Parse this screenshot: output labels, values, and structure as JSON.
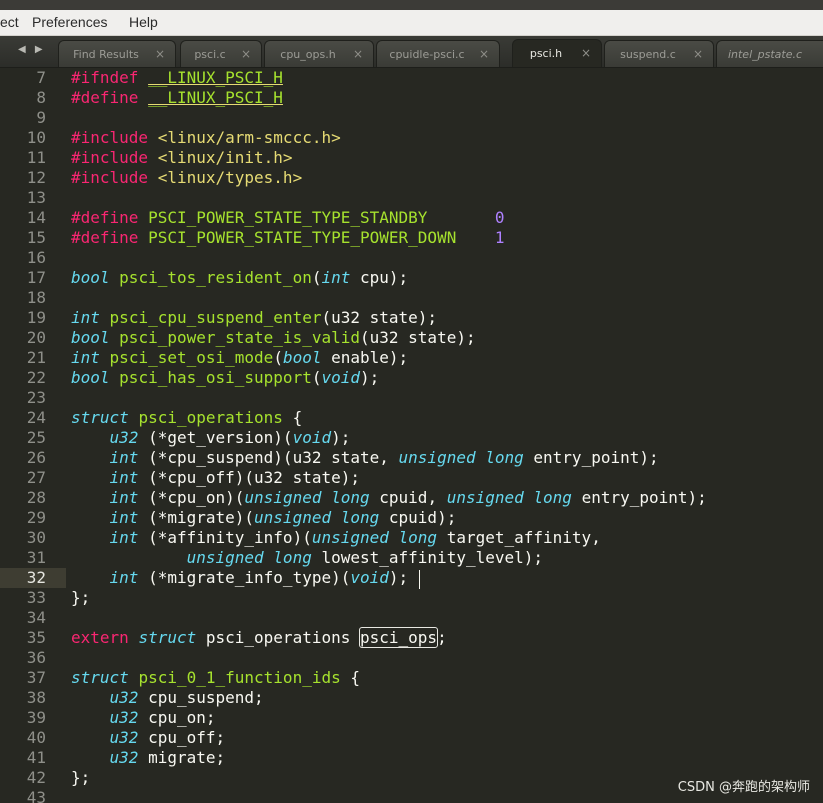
{
  "menu": {
    "items": [
      "ect",
      "Preferences",
      "Help"
    ]
  },
  "tabs": [
    {
      "label": "Find Results",
      "active": false
    },
    {
      "label": "psci.c",
      "active": false
    },
    {
      "label": "cpu_ops.h",
      "active": false
    },
    {
      "label": "cpuidle-psci.c",
      "active": false
    },
    {
      "label": "psci.h",
      "active": true
    },
    {
      "label": "suspend.c",
      "active": false
    },
    {
      "label": "intel_pstate.c",
      "active": false
    }
  ],
  "tab_close_glyph": "×",
  "tab_nav_glyph": "◀ ▶",
  "editor": {
    "current_line": 32,
    "lines": [
      {
        "n": 7,
        "tokens": [
          [
            "k",
            "#ifndef"
          ],
          [
            "p",
            " "
          ],
          [
            "u",
            "__LINUX_PSCI_H"
          ]
        ]
      },
      {
        "n": 8,
        "tokens": [
          [
            "k",
            "#define"
          ],
          [
            "p",
            " "
          ],
          [
            "u",
            "__LINUX_PSCI_H"
          ]
        ]
      },
      {
        "n": 9,
        "tokens": []
      },
      {
        "n": 10,
        "tokens": [
          [
            "k",
            "#include"
          ],
          [
            "p",
            " "
          ],
          [
            "s",
            "<linux/arm-smccc.h>"
          ]
        ]
      },
      {
        "n": 11,
        "tokens": [
          [
            "k",
            "#include"
          ],
          [
            "p",
            " "
          ],
          [
            "s",
            "<linux/init.h>"
          ]
        ]
      },
      {
        "n": 12,
        "tokens": [
          [
            "k",
            "#include"
          ],
          [
            "p",
            " "
          ],
          [
            "s",
            "<linux/types.h>"
          ]
        ]
      },
      {
        "n": 13,
        "tokens": []
      },
      {
        "n": 14,
        "tokens": [
          [
            "k",
            "#define"
          ],
          [
            "p",
            " "
          ],
          [
            "f",
            "PSCI_POWER_STATE_TYPE_STANDBY"
          ],
          [
            "p",
            "       "
          ],
          [
            "n",
            "0"
          ]
        ]
      },
      {
        "n": 15,
        "tokens": [
          [
            "k",
            "#define"
          ],
          [
            "p",
            " "
          ],
          [
            "f",
            "PSCI_POWER_STATE_TYPE_POWER_DOWN"
          ],
          [
            "p",
            "    "
          ],
          [
            "n",
            "1"
          ]
        ]
      },
      {
        "n": 16,
        "tokens": []
      },
      {
        "n": 17,
        "tokens": [
          [
            "t",
            "bool"
          ],
          [
            "p",
            " "
          ],
          [
            "f",
            "psci_tos_resident_on"
          ],
          [
            "p",
            "("
          ],
          [
            "t",
            "int"
          ],
          [
            "p",
            " cpu);"
          ]
        ]
      },
      {
        "n": 18,
        "tokens": []
      },
      {
        "n": 19,
        "tokens": [
          [
            "t",
            "int"
          ],
          [
            "p",
            " "
          ],
          [
            "f",
            "psci_cpu_suspend_enter"
          ],
          [
            "p",
            "(u32 state);"
          ]
        ]
      },
      {
        "n": 20,
        "tokens": [
          [
            "t",
            "bool"
          ],
          [
            "p",
            " "
          ],
          [
            "f",
            "psci_power_state_is_valid"
          ],
          [
            "p",
            "(u32 state);"
          ]
        ]
      },
      {
        "n": 21,
        "tokens": [
          [
            "t",
            "int"
          ],
          [
            "p",
            " "
          ],
          [
            "f",
            "psci_set_osi_mode"
          ],
          [
            "p",
            "("
          ],
          [
            "t",
            "bool"
          ],
          [
            "p",
            " enable);"
          ]
        ]
      },
      {
        "n": 22,
        "tokens": [
          [
            "t",
            "bool"
          ],
          [
            "p",
            " "
          ],
          [
            "f",
            "psci_has_osi_support"
          ],
          [
            "p",
            "("
          ],
          [
            "t",
            "void"
          ],
          [
            "p",
            ");"
          ]
        ]
      },
      {
        "n": 23,
        "tokens": []
      },
      {
        "n": 24,
        "tokens": [
          [
            "t",
            "struct"
          ],
          [
            "p",
            " "
          ],
          [
            "f",
            "psci_operations"
          ],
          [
            "p",
            " {"
          ]
        ]
      },
      {
        "n": 25,
        "tokens": [
          [
            "p",
            "    "
          ],
          [
            "t",
            "u32"
          ],
          [
            "p",
            " (*get_version)("
          ],
          [
            "t",
            "void"
          ],
          [
            "p",
            ");"
          ]
        ]
      },
      {
        "n": 26,
        "tokens": [
          [
            "p",
            "    "
          ],
          [
            "t",
            "int"
          ],
          [
            "p",
            " (*cpu_suspend)(u32 state, "
          ],
          [
            "t",
            "unsigned"
          ],
          [
            "p",
            " "
          ],
          [
            "t",
            "long"
          ],
          [
            "p",
            " entry_point);"
          ]
        ]
      },
      {
        "n": 27,
        "tokens": [
          [
            "p",
            "    "
          ],
          [
            "t",
            "int"
          ],
          [
            "p",
            " (*cpu_off)(u32 state);"
          ]
        ]
      },
      {
        "n": 28,
        "tokens": [
          [
            "p",
            "    "
          ],
          [
            "t",
            "int"
          ],
          [
            "p",
            " (*cpu_on)("
          ],
          [
            "t",
            "unsigned"
          ],
          [
            "p",
            " "
          ],
          [
            "t",
            "long"
          ],
          [
            "p",
            " cpuid, "
          ],
          [
            "t",
            "unsigned"
          ],
          [
            "p",
            " "
          ],
          [
            "t",
            "long"
          ],
          [
            "p",
            " entry_point);"
          ]
        ]
      },
      {
        "n": 29,
        "tokens": [
          [
            "p",
            "    "
          ],
          [
            "t",
            "int"
          ],
          [
            "p",
            " (*migrate)("
          ],
          [
            "t",
            "unsigned"
          ],
          [
            "p",
            " "
          ],
          [
            "t",
            "long"
          ],
          [
            "p",
            " cpuid);"
          ]
        ]
      },
      {
        "n": 30,
        "tokens": [
          [
            "p",
            "    "
          ],
          [
            "t",
            "int"
          ],
          [
            "p",
            " (*affinity_info)("
          ],
          [
            "t",
            "unsigned"
          ],
          [
            "p",
            " "
          ],
          [
            "t",
            "long"
          ],
          [
            "p",
            " target_affinity,"
          ]
        ]
      },
      {
        "n": 31,
        "tokens": [
          [
            "p",
            "            "
          ],
          [
            "t",
            "unsigned"
          ],
          [
            "p",
            " "
          ],
          [
            "t",
            "long"
          ],
          [
            "p",
            " lowest_affinity_level);"
          ]
        ]
      },
      {
        "n": 32,
        "tokens": [
          [
            "p",
            "    "
          ],
          [
            "t",
            "int"
          ],
          [
            "p",
            " (*migrate_info_type)("
          ],
          [
            "t",
            "void"
          ],
          [
            "p",
            ");"
          ]
        ]
      },
      {
        "n": 33,
        "tokens": [
          [
            "p",
            "};"
          ]
        ]
      },
      {
        "n": 34,
        "tokens": []
      },
      {
        "n": 35,
        "tokens": [
          [
            "k",
            "extern"
          ],
          [
            "p",
            " "
          ],
          [
            "t",
            "struct"
          ],
          [
            "p",
            " psci_operations "
          ],
          [
            "box",
            "psci_ops"
          ],
          [
            "p",
            ";"
          ]
        ]
      },
      {
        "n": 36,
        "tokens": []
      },
      {
        "n": 37,
        "tokens": [
          [
            "t",
            "struct"
          ],
          [
            "p",
            " "
          ],
          [
            "f",
            "psci_0_1_function_ids"
          ],
          [
            "p",
            " {"
          ]
        ]
      },
      {
        "n": 38,
        "tokens": [
          [
            "p",
            "    "
          ],
          [
            "t",
            "u32"
          ],
          [
            "p",
            " cpu_suspend;"
          ]
        ]
      },
      {
        "n": 39,
        "tokens": [
          [
            "p",
            "    "
          ],
          [
            "t",
            "u32"
          ],
          [
            "p",
            " cpu_on;"
          ]
        ]
      },
      {
        "n": 40,
        "tokens": [
          [
            "p",
            "    "
          ],
          [
            "t",
            "u32"
          ],
          [
            "p",
            " cpu_off;"
          ]
        ]
      },
      {
        "n": 41,
        "tokens": [
          [
            "p",
            "    "
          ],
          [
            "t",
            "u32"
          ],
          [
            "p",
            " migrate;"
          ]
        ]
      },
      {
        "n": 42,
        "tokens": [
          [
            "p",
            "};"
          ]
        ]
      },
      {
        "n": 43,
        "tokens": []
      }
    ]
  },
  "watermark": "CSDN @奔跑的架构师"
}
